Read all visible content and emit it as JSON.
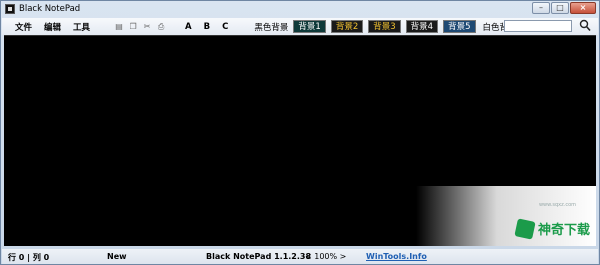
{
  "window": {
    "title": "Black NotePad"
  },
  "menu": [
    "文件",
    "编辑",
    "工具"
  ],
  "toolbar_icons": [
    "paste-icon",
    "copy-icon",
    "cut-icon",
    "print-icon"
  ],
  "format_buttons": [
    "A",
    "B",
    "C"
  ],
  "backgrounds": {
    "label_black": "黑色背景",
    "label_white": "白色背景",
    "buttons": [
      {
        "label": "背景1",
        "bg": "#0f3a3a",
        "fg": "#ffffff"
      },
      {
        "label": "背景2",
        "bg": "#1a1a1a",
        "fg": "#f2c230"
      },
      {
        "label": "背景3",
        "bg": "#1a1a1a",
        "fg": "#f2c230"
      },
      {
        "label": "背景4",
        "bg": "#1a1a1a",
        "fg": "#ffffff"
      },
      {
        "label": "背景5",
        "bg": "#1f4a74",
        "fg": "#ffffff"
      }
    ]
  },
  "search": {
    "value": "",
    "icon": "magnifier-icon"
  },
  "status": {
    "position": "行 0 | 列 0",
    "state": "New",
    "version": "Black NotePad 1.1.2.38",
    "zoom": "< 100% >",
    "site": "WinTools.Info"
  },
  "watermark": {
    "text": "神奇下载",
    "url": "www.sqxz.com"
  }
}
